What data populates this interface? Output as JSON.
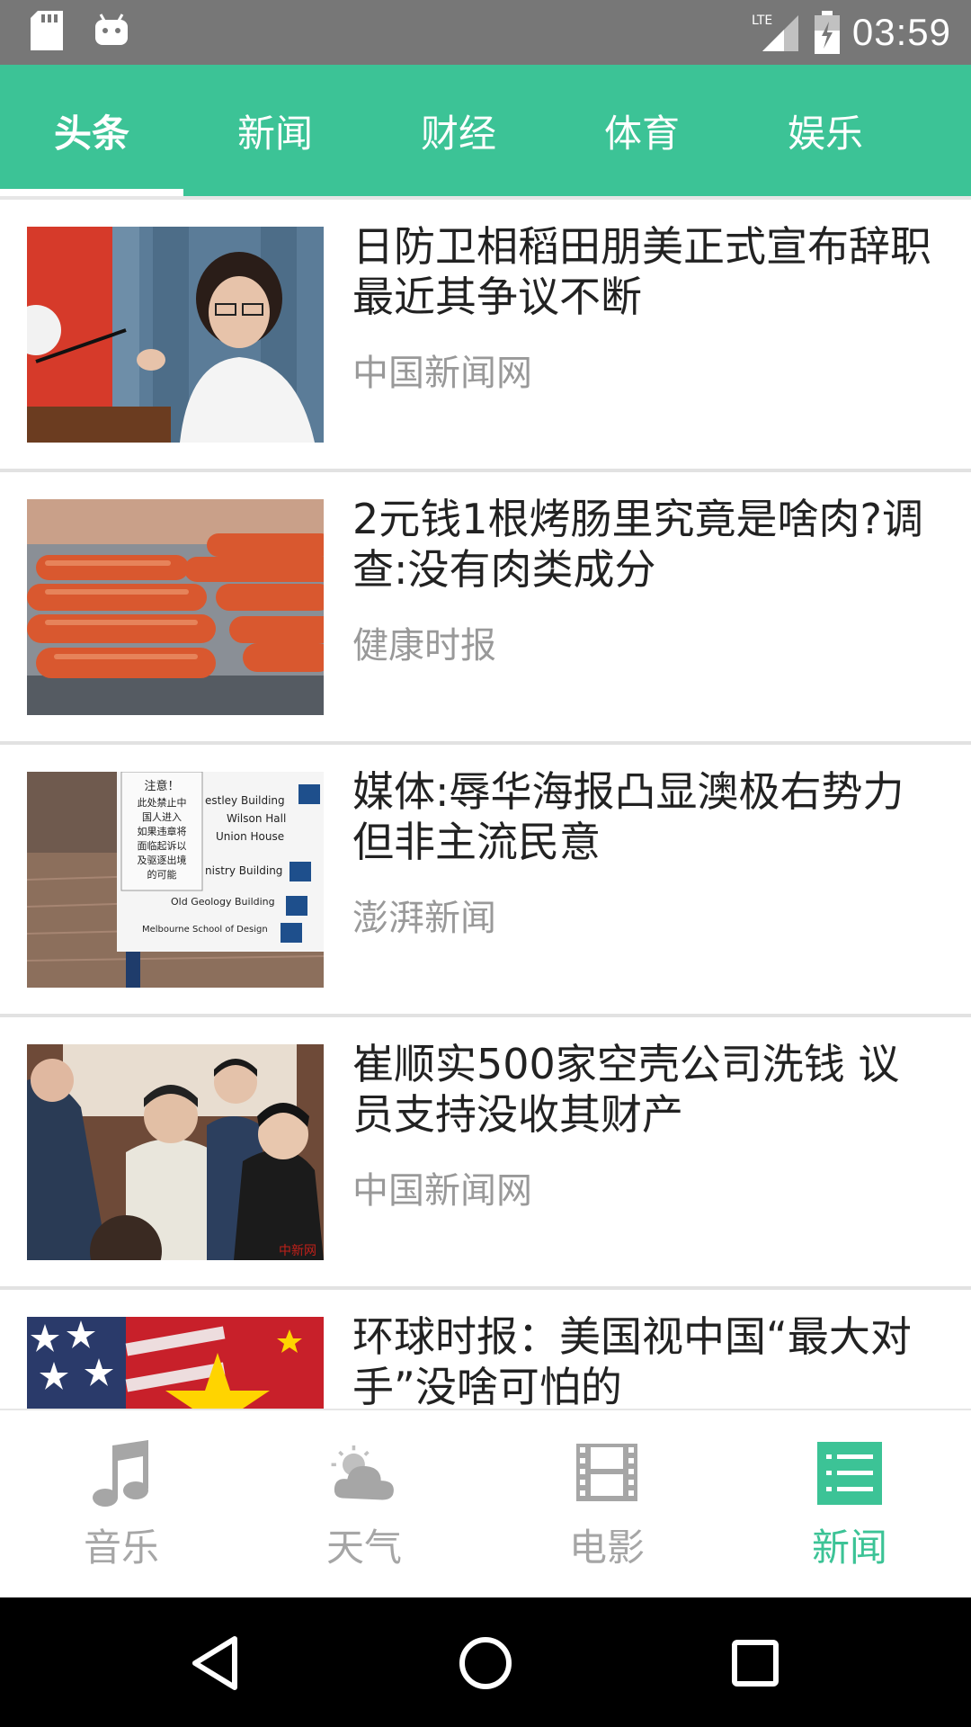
{
  "status_bar": {
    "time": "03:59",
    "network": "LTE",
    "icons": [
      "sd-card-icon",
      "android-icon",
      "signal-icon",
      "battery-icon"
    ]
  },
  "top_tabs": [
    {
      "label": "头条",
      "active": true
    },
    {
      "label": "新闻",
      "active": false
    },
    {
      "label": "财经",
      "active": false
    },
    {
      "label": "体育",
      "active": false
    },
    {
      "label": "娱乐",
      "active": false
    }
  ],
  "news": [
    {
      "title": "日防卫相稻田朋美正式宣布辞职 最近其争议不断",
      "source": "中国新闻网"
    },
    {
      "title": "2元钱1根烤肠里究竟是啥肉?调查:没有肉类成分",
      "source": "健康时报"
    },
    {
      "title": "媒体:辱华海报凸显澳极右势力但非主流民意",
      "source": "澎湃新闻"
    },
    {
      "title": "崔顺实500家空壳公司洗钱 议员支持没收其财产",
      "source": "中国新闻网"
    },
    {
      "title": "环球时报：美国视中国“最大对手”没啥可怕的",
      "source": ""
    }
  ],
  "thumb_text": {
    "notice": [
      "注意！",
      "此处禁止中",
      "国人进入",
      "如果违章将",
      "面临起诉以",
      "及驱逐出境",
      "的可能"
    ],
    "signs": [
      "estley Building",
      "Wilson Hall",
      "Union House",
      "nistry Building",
      "Old Geology Building",
      "Melbourne School of Design"
    ],
    "watermark": "中新网"
  },
  "bottom_nav": [
    {
      "label": "音乐",
      "icon": "music-note-icon",
      "active": false
    },
    {
      "label": "天气",
      "icon": "weather-icon",
      "active": false
    },
    {
      "label": "电影",
      "icon": "film-icon",
      "active": false
    },
    {
      "label": "新闻",
      "icon": "news-list-icon",
      "active": true
    }
  ],
  "colors": {
    "accent": "#3cc396",
    "status_bar": "#777777",
    "inactive": "#a6a6a6"
  }
}
